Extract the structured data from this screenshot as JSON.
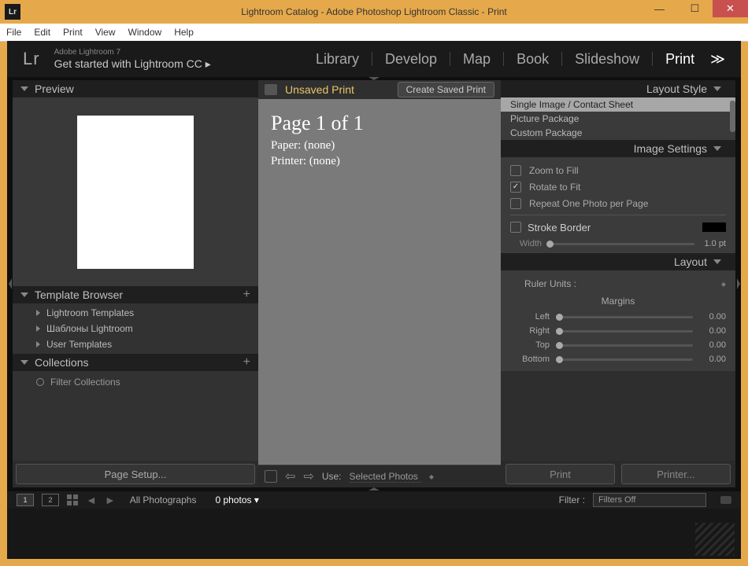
{
  "window": {
    "title": "Lightroom Catalog - Adobe Photoshop Lightroom Classic - Print"
  },
  "menubar": [
    "File",
    "Edit",
    "Print",
    "View",
    "Window",
    "Help"
  ],
  "identity": {
    "sub": "Adobe Lightroom 7",
    "main": "Get started with Lightroom CC ▸",
    "logo": "Lr"
  },
  "modules": [
    "Library",
    "Develop",
    "Map",
    "Book",
    "Slideshow",
    "Print"
  ],
  "module_extra": "≫",
  "left": {
    "preview_hd": "Preview",
    "tmpl_hd": "Template Browser",
    "tmpl_items": [
      "Lightroom Templates",
      "Шаблоны Lightroom",
      "User Templates"
    ],
    "coll_hd": "Collections",
    "coll_filter": "Filter Collections",
    "page_setup": "Page Setup..."
  },
  "center": {
    "unsaved": "Unsaved Print",
    "savedbtn": "Create Saved Print",
    "page": "Page 1 of 1",
    "paper": "Paper: (none)",
    "printer": "Printer: (none)",
    "use_lbl": "Use:",
    "use_val": "Selected Photos"
  },
  "right": {
    "layoutstyle_hd": "Layout Style",
    "layoutstyle_items": [
      "Single Image / Contact Sheet",
      "Picture Package",
      "Custom Package"
    ],
    "imgset_hd": "Image Settings",
    "zoom": "Zoom to Fill",
    "rotate": "Rotate to Fit",
    "repeat": "Repeat One Photo per Page",
    "stroke": "Stroke Border",
    "width_lbl": "Width",
    "width_val": "1.0 pt",
    "layout_hd": "Layout",
    "ruler": "Ruler Units :",
    "margins": "Margins",
    "margin_lbls": [
      "Left",
      "Right",
      "Top",
      "Bottom"
    ],
    "margin_vals": [
      "0.00",
      "0.00",
      "0.00",
      "0.00"
    ],
    "print": "Print",
    "printer": "Printer..."
  },
  "filmstrip": {
    "badge1": "1",
    "badge2": "2",
    "label": "All Photographs",
    "count": "0 photos",
    "filter_lbl": "Filter :",
    "filter_val": "Filters Off"
  }
}
